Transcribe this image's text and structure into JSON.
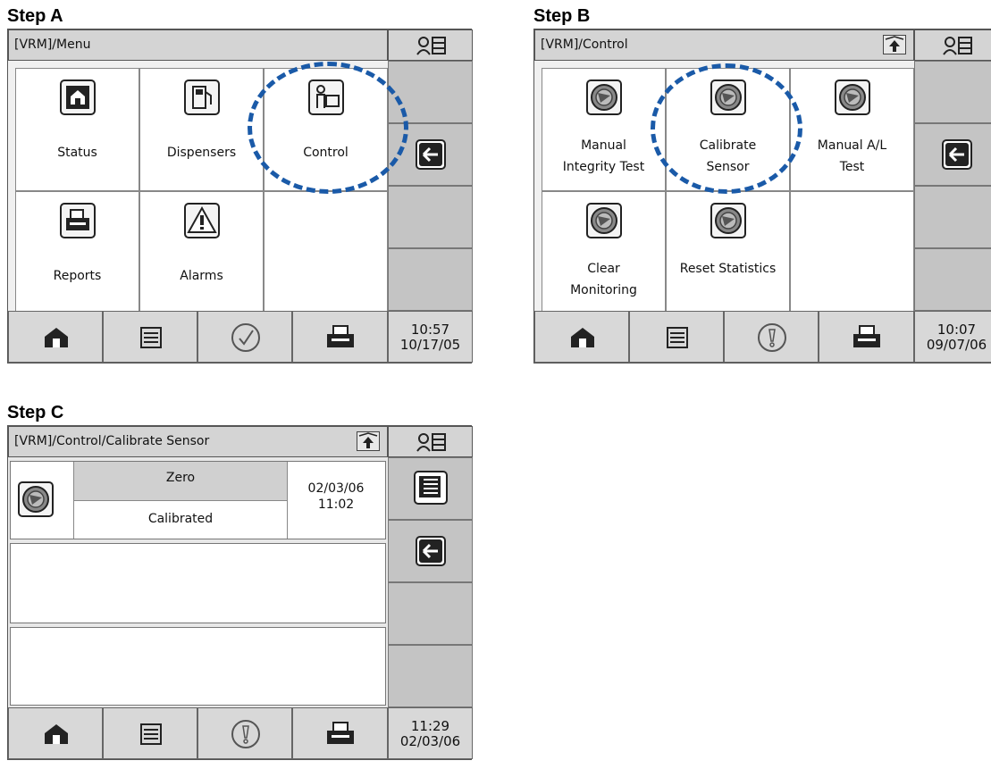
{
  "steps": {
    "a": {
      "label": "Step A",
      "title": "[VRM]/Menu",
      "tiles": [
        "Status",
        "Dispensers",
        "Control",
        "Reports",
        "Alarms"
      ],
      "clock_time": "10:57",
      "clock_date": "10/17/05"
    },
    "b": {
      "label": "Step B",
      "title": "[VRM]/Control",
      "tiles": [
        {
          "line1": "Manual",
          "line2": "Integrity Test"
        },
        {
          "line1": "Calibrate",
          "line2": "Sensor"
        },
        {
          "line1": "Manual A/L",
          "line2": "Test"
        },
        {
          "line1": "Clear",
          "line2": "Monitoring"
        },
        {
          "line1": "Reset Statistics",
          "line2": ""
        }
      ],
      "clock_time": "10:07",
      "clock_date": "09/07/06"
    },
    "c": {
      "label": "Step C",
      "title": "[VRM]/Control/Calibrate Sensor",
      "row_zero": "Zero",
      "row_status": "Calibrated",
      "row_date": "02/03/06",
      "row_time": "11:02",
      "clock_time": "11:29",
      "clock_date": "02/03/06"
    }
  },
  "colors": {
    "highlight_dash": "#1a5aa8",
    "screen_bg": "#c8c8c8",
    "tile_bg": "#ffffff"
  },
  "icons": {
    "home": "home-icon",
    "list": "list-icon",
    "check": "checkmark-icon",
    "alert": "alert-circle-icon",
    "printer": "printer-icon",
    "back": "back-arrow-icon",
    "user": "user-panel-icon",
    "up": "up-arrow-icon",
    "gauge": "sensor-gauge-icon"
  }
}
